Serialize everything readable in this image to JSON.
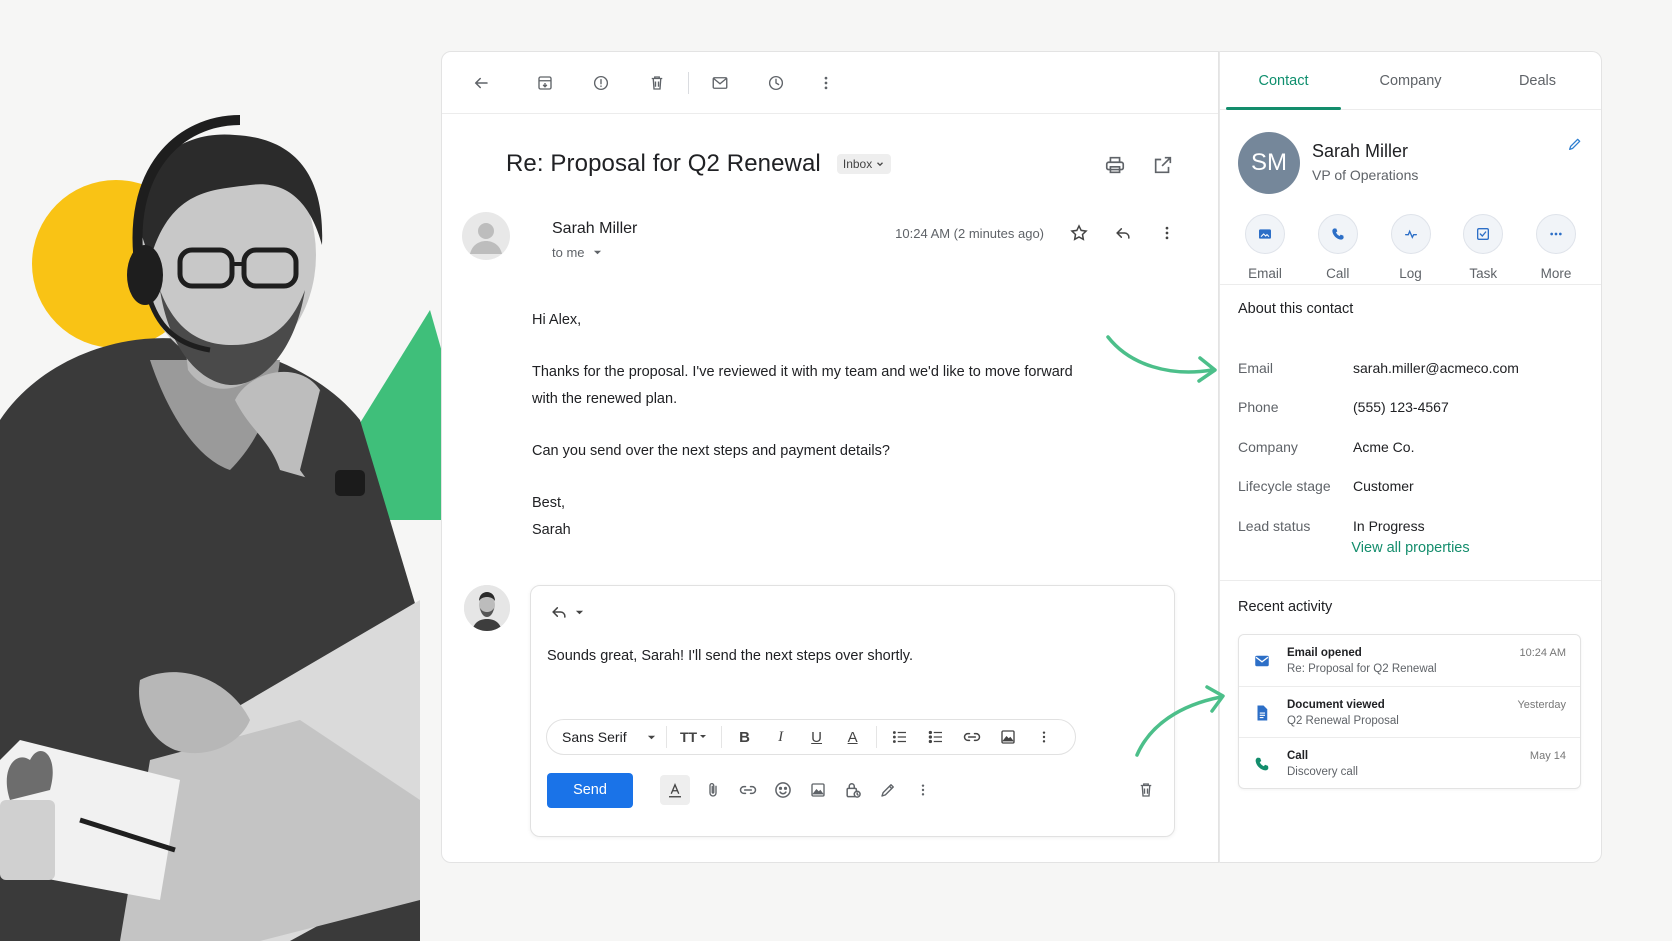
{
  "colors": {
    "accent_green": "#138d6c",
    "send_blue": "#1a73e8",
    "deco_yellow": "#f9c315",
    "deco_green": "#3fbf7a"
  },
  "toolbar": {
    "icons": [
      "back-arrow-icon",
      "archive-icon",
      "report-spam-icon",
      "delete-icon",
      "mark-unread-icon",
      "snooze-icon",
      "more-vertical-icon"
    ]
  },
  "email": {
    "subject": "Re: Proposal for Q2 Renewal",
    "label_chip": "Inbox",
    "sender_name": "Sarah Miller",
    "recipient": "to me",
    "timestamp": "10:24 AM (2 minutes ago)",
    "body": [
      "Hi Alex,",
      "Thanks for the proposal. I've reviewed it with my team and we'd like to move forward with the renewed plan.",
      "Can you send over the next steps and payment details?",
      "Best,",
      "Sarah"
    ]
  },
  "reply": {
    "text": "Sounds great, Sarah! I'll send the next steps over shortly.",
    "font": "Sans Serif",
    "send_label": "Send"
  },
  "contact_panel": {
    "tabs": [
      "Contact",
      "Company",
      "Deals"
    ],
    "active_tab": "Contact",
    "initials": "SM",
    "name": "Sarah Miller",
    "title": "VP of Operations",
    "actions": [
      "Email",
      "Call",
      "Log",
      "Task",
      "More"
    ],
    "about_title": "About this contact",
    "properties": [
      {
        "label": "Email",
        "value": "sarah.miller@acmeco.com"
      },
      {
        "label": "Phone",
        "value": "(555) 123-4567"
      },
      {
        "label": "Company",
        "value": "Acme Co."
      },
      {
        "label": "Lifecycle stage",
        "value": "Customer"
      },
      {
        "label": "Lead status",
        "value": "In Progress"
      }
    ],
    "view_all": "View all properties",
    "activity_title": "Recent activity",
    "activity": [
      {
        "title": "Email opened",
        "subtitle": "Re: Proposal for Q2 Renewal",
        "time": "10:24 AM",
        "icon": "envelope-icon"
      },
      {
        "title": "Document viewed",
        "subtitle": "Q2 Renewal Proposal",
        "time": "Yesterday",
        "icon": "document-icon"
      },
      {
        "title": "Call",
        "subtitle": "Discovery call",
        "time": "May 14",
        "icon": "phone-icon"
      }
    ]
  }
}
